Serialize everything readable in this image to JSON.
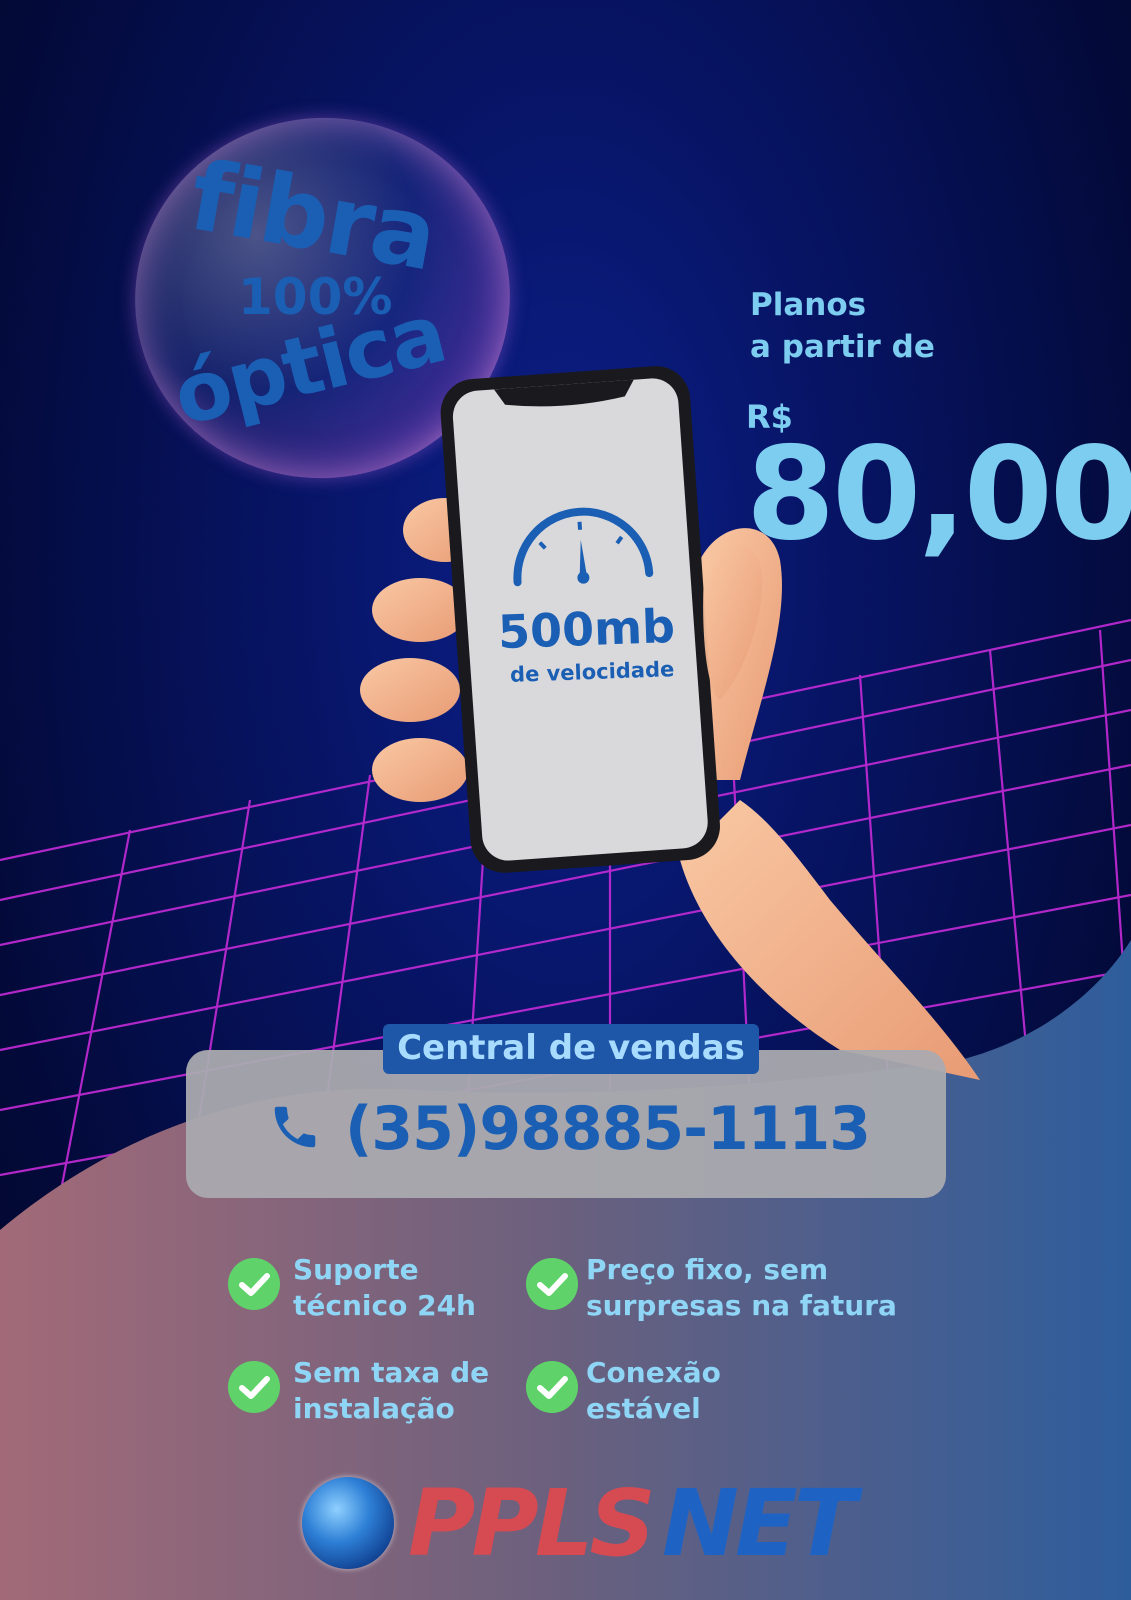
{
  "bubble": {
    "line1": "fibra",
    "line2": "100%",
    "line3": "óptica"
  },
  "offer": {
    "line1": "Planos",
    "line2": "a partir de",
    "currency": "R$",
    "price": "80,00"
  },
  "phone_screen": {
    "speed": "500mb",
    "speed_label": "de velocidade"
  },
  "contact": {
    "label": "Central de vendas",
    "number": "(35)98885-1113"
  },
  "features": [
    {
      "line1": "Suporte",
      "line2": "técnico 24h"
    },
    {
      "line1": "Preço fixo, sem",
      "line2": "surpresas na fatura"
    },
    {
      "line1": "Sem taxa de",
      "line2": "instalação"
    },
    {
      "line1": "Conexão",
      "line2": "estável"
    }
  ],
  "logo": {
    "part1": "PPLS",
    "part2": "NET"
  },
  "colors": {
    "accent_blue": "#1a5fb4",
    "light_blue": "#7ccdf0",
    "check_green": "#5fd36a",
    "grid_magenta": "#c42bd8"
  }
}
